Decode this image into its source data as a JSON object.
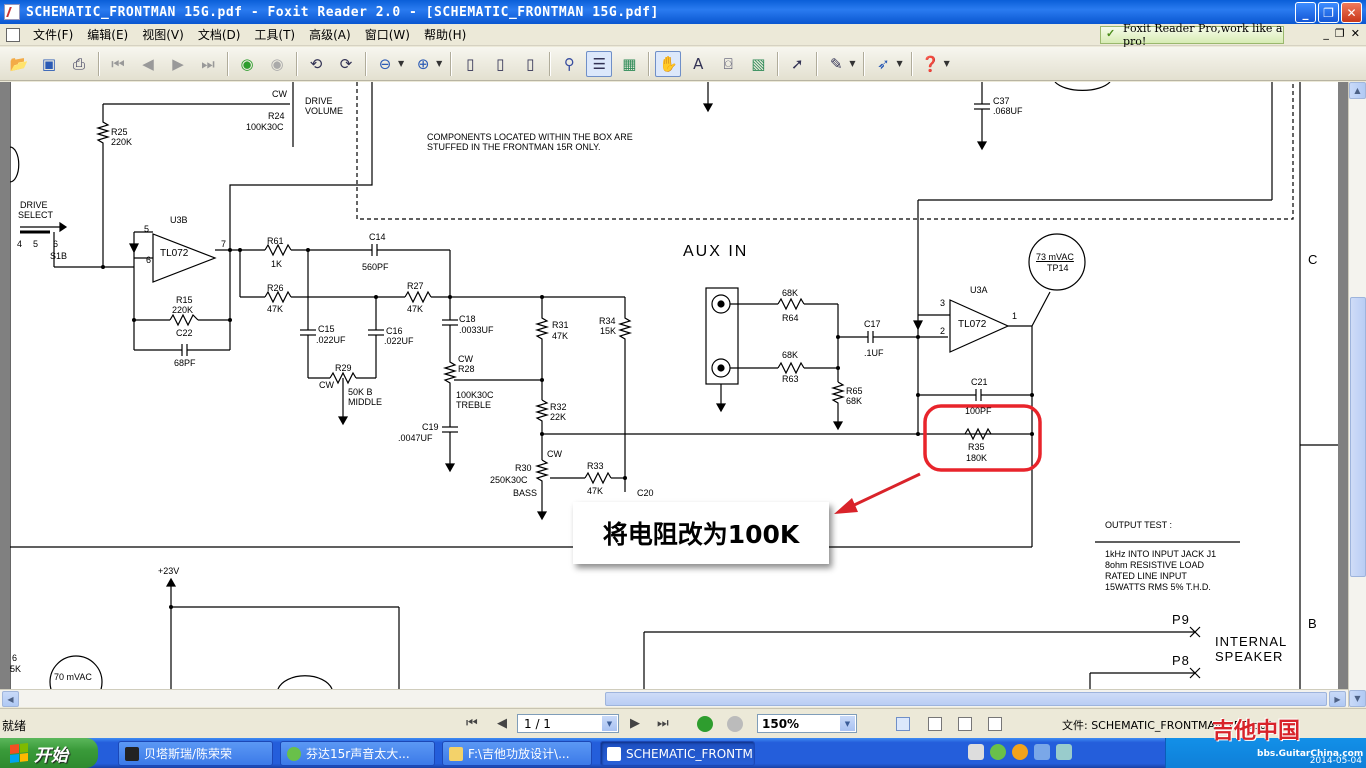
{
  "window": {
    "title": "SCHEMATIC_FRONTMAN 15G.pdf - Foxit Reader 2.0 - [SCHEMATIC_FRONTMAN 15G.pdf]"
  },
  "menu": {
    "items": [
      "文件(F)",
      "编辑(E)",
      "视图(V)",
      "文档(D)",
      "工具(T)",
      "高级(A)",
      "窗口(W)",
      "帮助(H)"
    ],
    "promo": "Foxit Reader Pro,work like a pro!"
  },
  "toolbar": {
    "icons": [
      "open-icon",
      "save-icon",
      "print-icon",
      "first-page-icon",
      "prev-page-icon",
      "next-page-icon",
      "last-page-icon",
      "back-icon",
      "forward-icon",
      "rotate-left-icon",
      "rotate-right-icon",
      "zoom-out-icon",
      "zoom-in-icon",
      "page-icon",
      "two-page-icon",
      "continuous-icon",
      "find-icon",
      "bookmark-panel-icon",
      "thumbnail-icon",
      "hand-icon",
      "text-select-icon",
      "snapshot-icon",
      "image-select-icon",
      "pointer-icon",
      "comment-icon",
      "typewriter-icon",
      "help-icon"
    ]
  },
  "schematic": {
    "labels": [
      {
        "id": "cw-top",
        "text": "CW"
      },
      {
        "id": "drive-volume-1",
        "text": "DRIVE"
      },
      {
        "id": "drive-volume-2",
        "text": "VOLUME"
      },
      {
        "id": "r24",
        "text": "R24"
      },
      {
        "id": "r24-val",
        "text": "100K30C"
      },
      {
        "id": "r25",
        "text": "R25"
      },
      {
        "id": "r25-val",
        "text": "220K"
      },
      {
        "id": "box-note-1",
        "text": "COMPONENTS LOCATED WITHIN THE BOX ARE"
      },
      {
        "id": "box-note-2",
        "text": "STUFFED IN THE FRONTMAN 15R ONLY."
      },
      {
        "id": "c37",
        "text": "C37"
      },
      {
        "id": "c37-val",
        "text": ".068UF"
      },
      {
        "id": "drive-select-1",
        "text": "DRIVE"
      },
      {
        "id": "drive-select-2",
        "text": "SELECT"
      },
      {
        "id": "s1b",
        "text": "S1B"
      },
      {
        "id": "pin4",
        "text": "4"
      },
      {
        "id": "pin5",
        "text": "5"
      },
      {
        "id": "pin6",
        "text": "6"
      },
      {
        "id": "u3b",
        "text": "U3B"
      },
      {
        "id": "tl072-b",
        "text": "TL072"
      },
      {
        "id": "u3b-5",
        "text": "5"
      },
      {
        "id": "u3b-6",
        "text": "6"
      },
      {
        "id": "u3b-7",
        "text": "7"
      },
      {
        "id": "r61",
        "text": "R61"
      },
      {
        "id": "r61-val",
        "text": "1K"
      },
      {
        "id": "c14",
        "text": "C14"
      },
      {
        "id": "c14-val",
        "text": "560PF"
      },
      {
        "id": "r26",
        "text": "R26"
      },
      {
        "id": "r26-val",
        "text": "47K"
      },
      {
        "id": "r27",
        "text": "R27"
      },
      {
        "id": "r27-val",
        "text": "47K"
      },
      {
        "id": "r15",
        "text": "R15"
      },
      {
        "id": "r15-val",
        "text": "220K"
      },
      {
        "id": "c22",
        "text": "C22"
      },
      {
        "id": "c22-val",
        "text": "68PF"
      },
      {
        "id": "c15",
        "text": "C15"
      },
      {
        "id": "c15-val",
        "text": ".022UF"
      },
      {
        "id": "c16",
        "text": "C16"
      },
      {
        "id": "c16-val",
        "text": ".022UF"
      },
      {
        "id": "c18",
        "text": "C18"
      },
      {
        "id": "c18-val",
        "text": ".0033UF"
      },
      {
        "id": "r29",
        "text": "R29"
      },
      {
        "id": "cw-r29",
        "text": "CW"
      },
      {
        "id": "r29-val-1",
        "text": "50K B"
      },
      {
        "id": "r29-val-2",
        "text": "MIDDLE"
      },
      {
        "id": "cw-r28",
        "text": "CW"
      },
      {
        "id": "r28",
        "text": "R28"
      },
      {
        "id": "r28-val-1",
        "text": "100K30C"
      },
      {
        "id": "r28-val-2",
        "text": "TREBLE"
      },
      {
        "id": "c19",
        "text": "C19"
      },
      {
        "id": "c19-val",
        "text": ".0047UF"
      },
      {
        "id": "r31",
        "text": "R31"
      },
      {
        "id": "r31-val",
        "text": "47K"
      },
      {
        "id": "r34",
        "text": "R34"
      },
      {
        "id": "r34-val",
        "text": "15K"
      },
      {
        "id": "r32",
        "text": "R32"
      },
      {
        "id": "r32-val",
        "text": "22K"
      },
      {
        "id": "cw-r30",
        "text": "CW"
      },
      {
        "id": "r30",
        "text": "R30"
      },
      {
        "id": "r30-val-1",
        "text": "250K30C"
      },
      {
        "id": "r30-val-2",
        "text": "BASS"
      },
      {
        "id": "r33",
        "text": "R33"
      },
      {
        "id": "r33-val",
        "text": "47K"
      },
      {
        "id": "c20",
        "text": "C20"
      },
      {
        "id": "r64-val",
        "text": "68K"
      },
      {
        "id": "r64",
        "text": "R64"
      },
      {
        "id": "r63-val",
        "text": "68K"
      },
      {
        "id": "r63",
        "text": "R63"
      },
      {
        "id": "c17",
        "text": "C17"
      },
      {
        "id": "c17-val",
        "text": ".1UF"
      },
      {
        "id": "r65",
        "text": "R65"
      },
      {
        "id": "r65-val",
        "text": "68K"
      },
      {
        "id": "u3a",
        "text": "U3A"
      },
      {
        "id": "tl072-a",
        "text": "TL072"
      },
      {
        "id": "u3a-3",
        "text": "3"
      },
      {
        "id": "u3a-2",
        "text": "2"
      },
      {
        "id": "u3a-1",
        "text": "1"
      },
      {
        "id": "tp14-1",
        "text": "73 mVAC"
      },
      {
        "id": "tp14-2",
        "text": "TP14"
      },
      {
        "id": "c21",
        "text": "C21"
      },
      {
        "id": "c21-val",
        "text": "100PF"
      },
      {
        "id": "r35",
        "text": "R35"
      },
      {
        "id": "r35-val",
        "text": "180K"
      },
      {
        "id": "output-test",
        "text": "OUTPUT   TEST :"
      },
      {
        "id": "ot-1",
        "text": "1kHz INTO INPUT JACK J1"
      },
      {
        "id": "ot-2",
        "text": "8ohm RESISTIVE LOAD"
      },
      {
        "id": "ot-3",
        "text": "RATED LINE INPUT"
      },
      {
        "id": "ot-4",
        "text": "15WATTS RMS 5% T.H.D."
      },
      {
        "id": "v23",
        "text": "+23V"
      },
      {
        "id": "p9",
        "text": "P9"
      },
      {
        "id": "p8",
        "text": "P8"
      },
      {
        "id": "int-speaker-1",
        "text": "INTERNAL"
      },
      {
        "id": "int-speaker-2",
        "text": "SPEAKER"
      },
      {
        "id": "tp-bottom",
        "text": "70 mVAC"
      },
      {
        "id": "left-6",
        "text": "6"
      },
      {
        "id": "left-5k",
        "text": "5K"
      }
    ],
    "aux_in": "AUX IN",
    "zone_c": "C",
    "zone_b": "B",
    "annotation": "将电阻改为100K",
    "highlight_color": "#e8242b"
  },
  "status": {
    "text": "就绪",
    "page": "1 / 1",
    "zoom": "150%",
    "file": "文件: SCHEMATIC_FRONTMAN 15G.pdf"
  },
  "taskbar": {
    "start": "开始",
    "tasks": [
      "贝塔斯瑞/陈荣荣",
      "芬达15r声音太大...",
      "F:\\吉他功放设计\\...",
      "SCHEMATIC_FRONTM..."
    ],
    "clock": "2014-05-04"
  },
  "watermark": {
    "text": "吉他中国",
    "url": "bbs.GuitarChina.com"
  }
}
